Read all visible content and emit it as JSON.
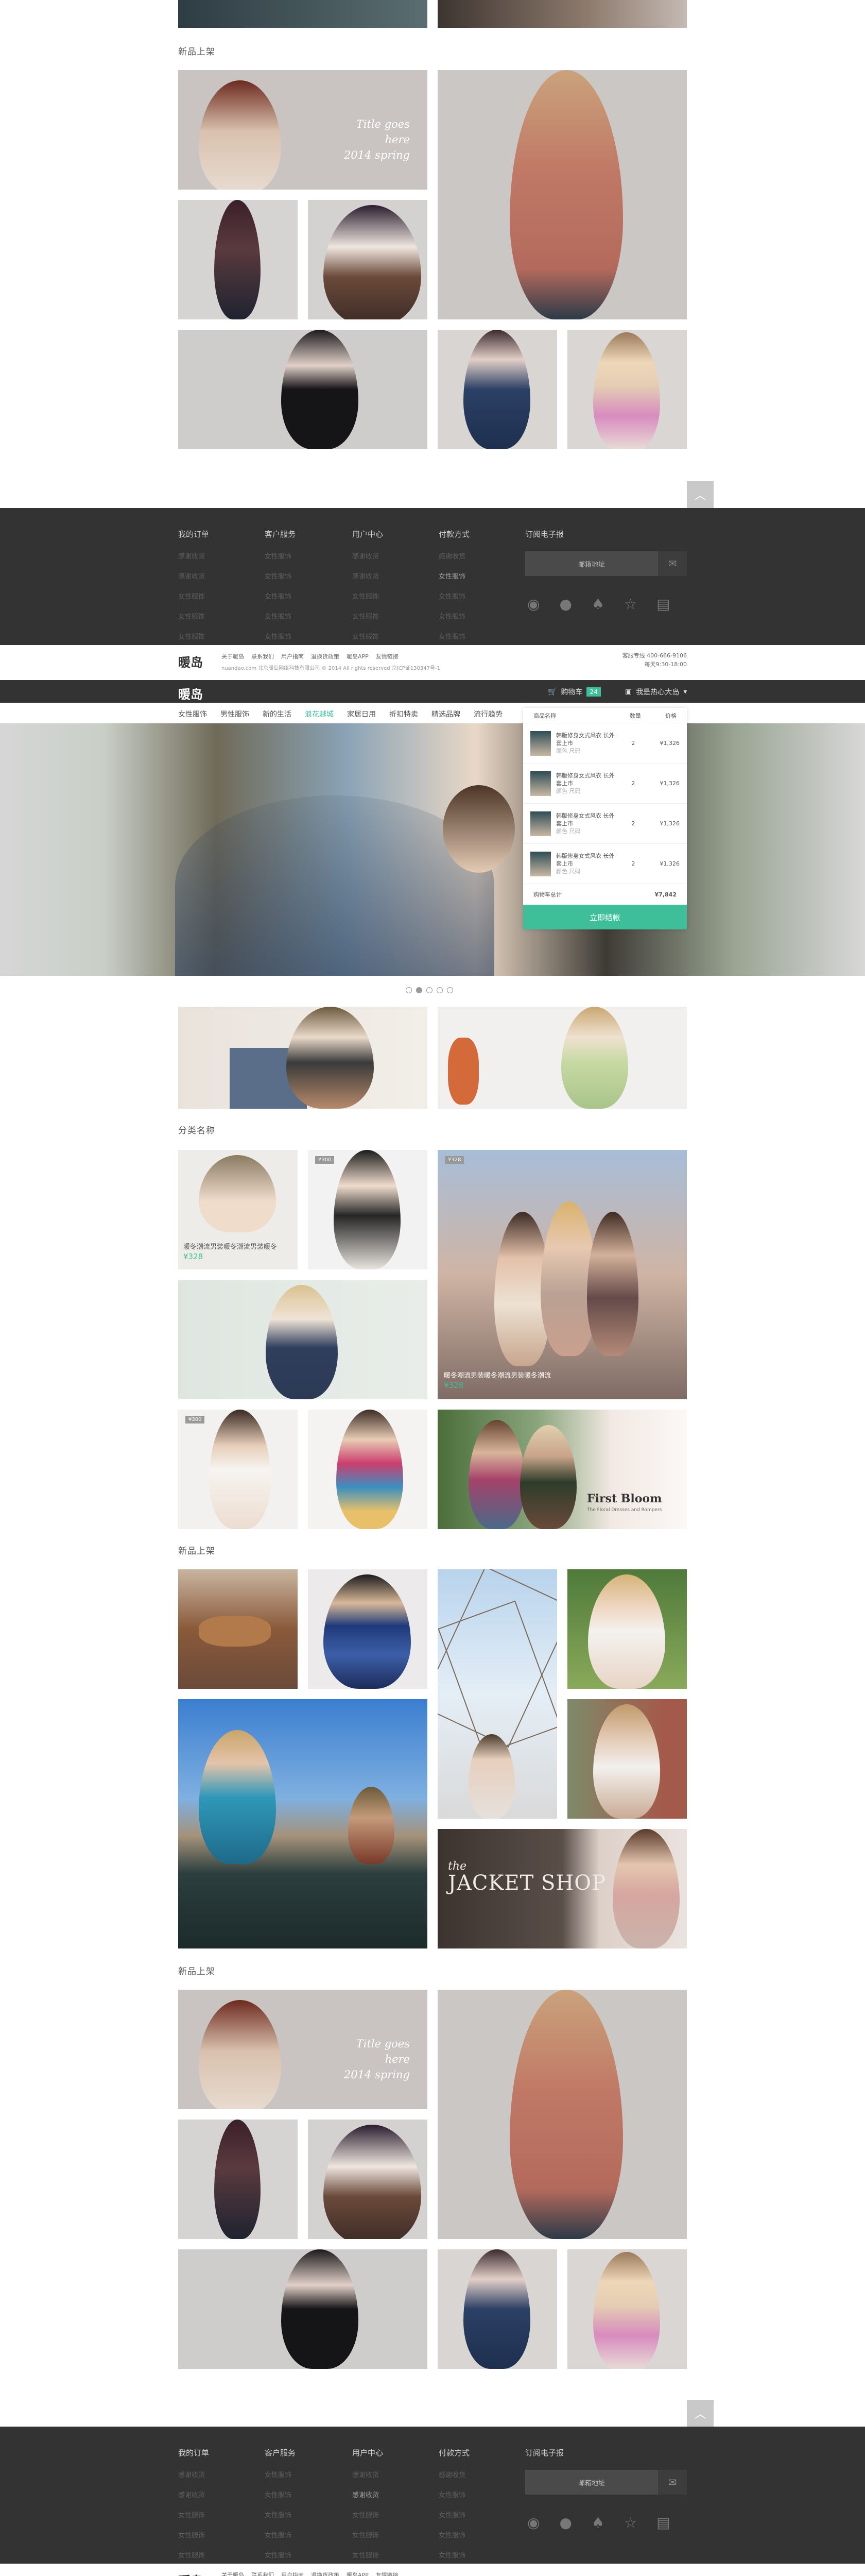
{
  "page": {
    "new_arrivals": "新品上架",
    "category": "分类名称"
  },
  "banner_text": {
    "line1": "Title goes here",
    "line2": "2014 spring"
  },
  "footer": {
    "cols": [
      {
        "h": "我的订单",
        "links": [
          "感谢收货",
          "感谢收货",
          "女性服饰",
          "女性服饰",
          "女性服饰"
        ]
      },
      {
        "h": "客户服务",
        "links": [
          "女性服饰",
          "女性服饰",
          "女性服饰",
          "女性服饰",
          "女性服饰"
        ]
      },
      {
        "h": "用户中心",
        "links": [
          "感谢收货",
          "感谢收货",
          "女性服饰",
          "女性服饰",
          "女性服饰"
        ]
      },
      {
        "h": "付款方式",
        "links": [
          "感谢收货",
          "女性服饰",
          "女性服饰",
          "女性服饰",
          "女性服饰"
        ]
      },
      {
        "h": "订阅电子报",
        "links": []
      }
    ],
    "email_placeholder": "邮箱地址",
    "email_icon": "✉",
    "social": [
      "weibo-icon",
      "wechat-icon",
      "qq-icon",
      "star-icon",
      "doc-icon"
    ],
    "totop": "︿"
  },
  "legal": {
    "logo": "暖岛",
    "links": [
      "关于暖岛",
      "联系我们",
      "用户指南",
      "退换货政策",
      "暖岛APP",
      "友情链接"
    ],
    "copy": "nuandao.com 北京暖岛网络科技有限公司 © 2014 All rights reserved 京ICP证130347号-1",
    "phone_line1": "客服专线 400-666-9106",
    "phone_line2": "每天9:30-18:00"
  },
  "topbar": {
    "logo": "暖岛",
    "cart_label": "购物车",
    "cart_count": "24",
    "user": "我是热心大岛"
  },
  "nav": [
    "女性服饰",
    "男性服饰",
    "新的生活",
    "浪花越城",
    "家居日用",
    "折扣特卖",
    "精选品牌",
    "流行趋势"
  ],
  "nav_active_index": 3,
  "minicart": {
    "headers": [
      "商品名称",
      "数量",
      "价格"
    ],
    "items": [
      {
        "name": "韩版修身女式风衣 长外套上市",
        "sub": "颜色 尺码",
        "qty": "2",
        "price": "¥1,326"
      },
      {
        "name": "韩版修身女式风衣 长外套上市",
        "sub": "颜色 尺码",
        "qty": "2",
        "price": "¥1,326"
      },
      {
        "name": "韩版修身女式风衣 长外套上市",
        "sub": "颜色 尺码",
        "qty": "2",
        "price": "¥1,326"
      },
      {
        "name": "韩版修身女式风衣 长外套上市",
        "sub": "颜色 尺码",
        "qty": "2",
        "price": "¥1,326"
      }
    ],
    "total_label": "购物车总计",
    "total_value": "¥7,842",
    "checkout": "立即结帐"
  },
  "products": {
    "p1_caption": "暖冬潮流男装暖冬潮流男装暖冬",
    "p1_price": "¥328",
    "p2_caption": "暖冬潮流男装暖冬潮流男装暖冬潮流",
    "p2_price": "¥328",
    "tag_a": "¥300",
    "tag_b": "¥328",
    "tag_c": "¥300",
    "first_bloom": "First Bloom",
    "first_bloom_sub": "The Floral Dresses and Rompers",
    "jacket_shop_the": "the",
    "jacket_shop": "JACKET SHOP"
  }
}
